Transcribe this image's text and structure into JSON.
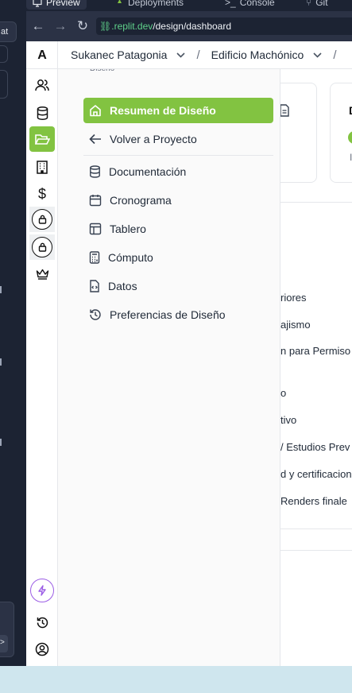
{
  "ide": {
    "chip_label": "at",
    "send_label": ">"
  },
  "browser": {
    "tabs": [
      {
        "label": "Preview",
        "active": true
      },
      {
        "label": "Deployments",
        "active": false
      },
      {
        "label": "Console",
        "active": false
      },
      {
        "label": "Git",
        "active": false
      }
    ],
    "url_host": ".replit.dev",
    "url_path": "/design/dashboard"
  },
  "app": {
    "logo": "A",
    "breadcrumbs": [
      {
        "label": "Sukanec Patagonia"
      },
      {
        "label": "Edificio Machónico"
      }
    ],
    "crumb_separator": "/",
    "menu_clipped_label": "Diseño",
    "menu": [
      {
        "label": "Resumen de Diseño",
        "icon": "home-icon",
        "active": true
      },
      {
        "label": "Volver a Proyecto",
        "icon": "arrow-left-icon",
        "active": false
      },
      {
        "label": "Documentación",
        "icon": "database-icon",
        "active": false
      },
      {
        "label": "Cronograma",
        "icon": "calendar-icon",
        "active": false
      },
      {
        "label": "Tablero",
        "icon": "layout-icon",
        "active": false
      },
      {
        "label": "Cómputo",
        "icon": "calculator-icon",
        "active": false
      },
      {
        "label": "Datos",
        "icon": "file-code-icon",
        "active": false
      },
      {
        "label": "Preferencias de Diseño",
        "icon": "history-icon",
        "active": false
      }
    ],
    "background_items": [
      "riores",
      "ajismo",
      "n para Permiso",
      "o",
      "tivo",
      "/ Estudios Prev",
      "d y certificacion",
      "Renders finale"
    ],
    "card_initial": "D",
    "card_sub": "I",
    "colors": {
      "accent": "#82c341",
      "ide_bg": "#1c2333",
      "url_host": "#5fd08a",
      "bolt": "#9b5de5"
    }
  }
}
